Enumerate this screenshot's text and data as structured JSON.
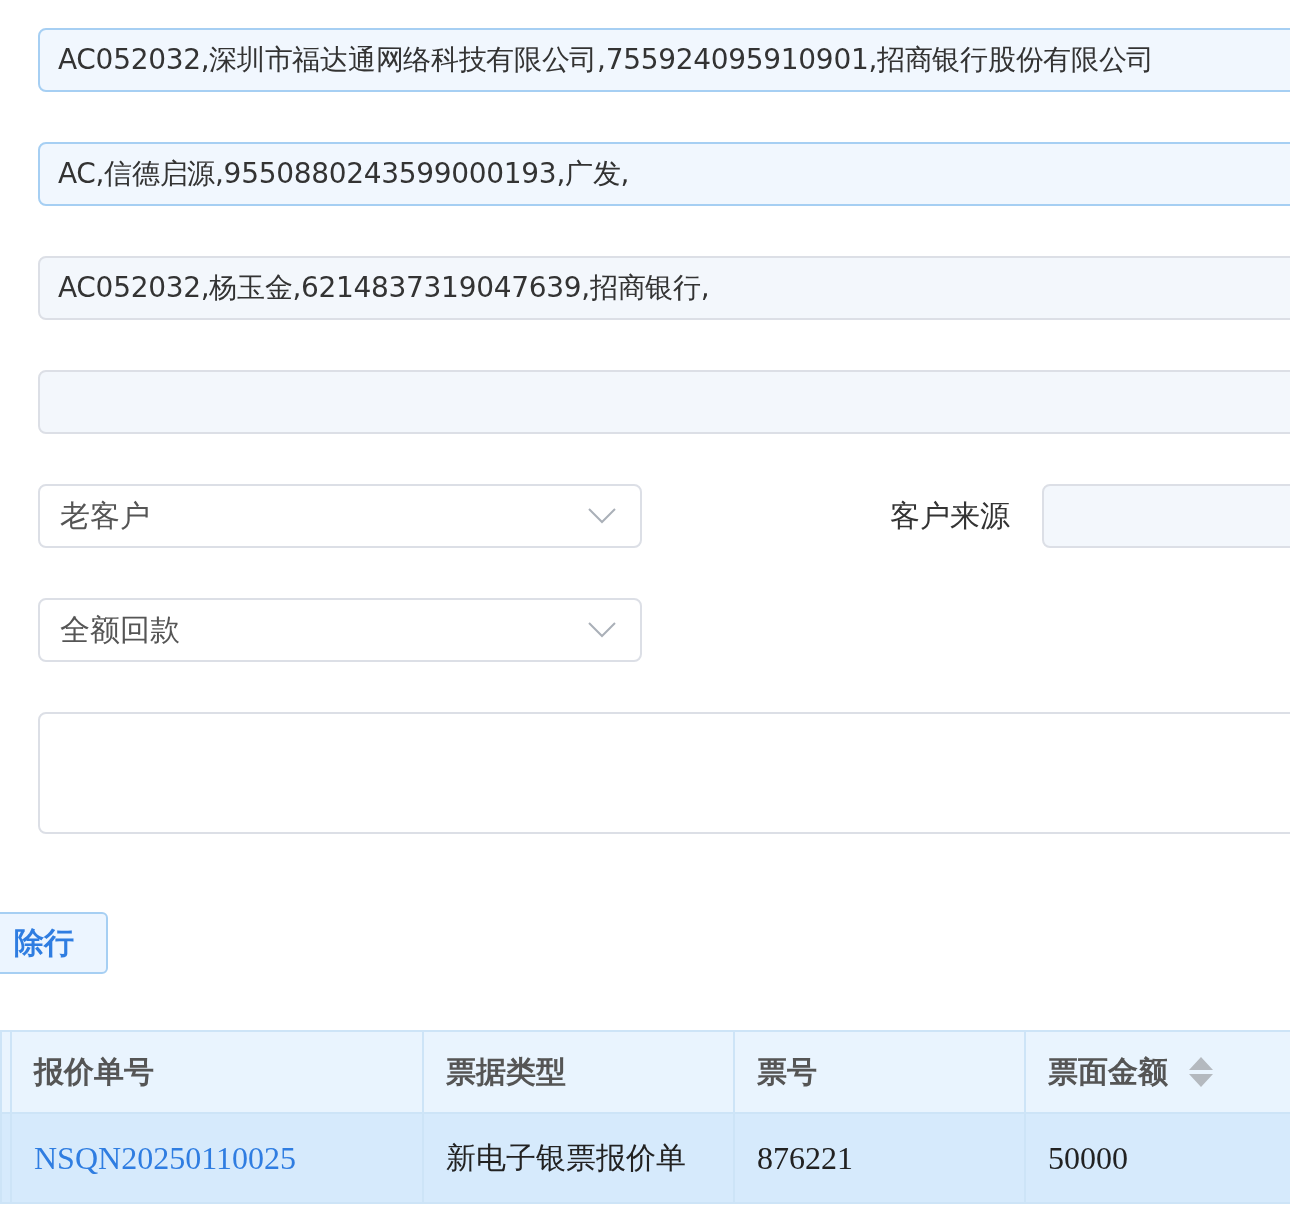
{
  "form": {
    "rows": [
      {
        "kind": "input",
        "value": "AC052032,深圳市福达通网络科技有限公司,755924095910901,招商银行股份有限公司",
        "highlighted": true
      },
      {
        "kind": "input",
        "value": "AC,信德启源,9550880243599000193,广发,",
        "highlighted": true
      },
      {
        "kind": "input",
        "value": "AC052032,杨玉金,6214837319047639,招商银行,",
        "highlighted": false
      },
      {
        "kind": "input",
        "value": "",
        "highlighted": false
      },
      {
        "kind": "select",
        "value": "老客户",
        "side_label": "客户来源"
      },
      {
        "kind": "select",
        "value": "全额回款"
      },
      {
        "kind": "textarea",
        "value": ""
      }
    ]
  },
  "row_button": {
    "label": "除行"
  },
  "table": {
    "columns": [
      {
        "label": "报价单号",
        "sortable": false
      },
      {
        "label": "票据类型",
        "sortable": false
      },
      {
        "label": "票号",
        "sortable": false
      },
      {
        "label": "票面金额",
        "sortable": true
      }
    ],
    "rows": [
      {
        "selected": true,
        "cells": [
          {
            "kind": "link",
            "text": "NSQN20250110025"
          },
          {
            "kind": "text",
            "text": "新电子银票报价单"
          },
          {
            "kind": "text",
            "text": "876221"
          },
          {
            "kind": "text",
            "text": "50000"
          }
        ]
      }
    ]
  }
}
